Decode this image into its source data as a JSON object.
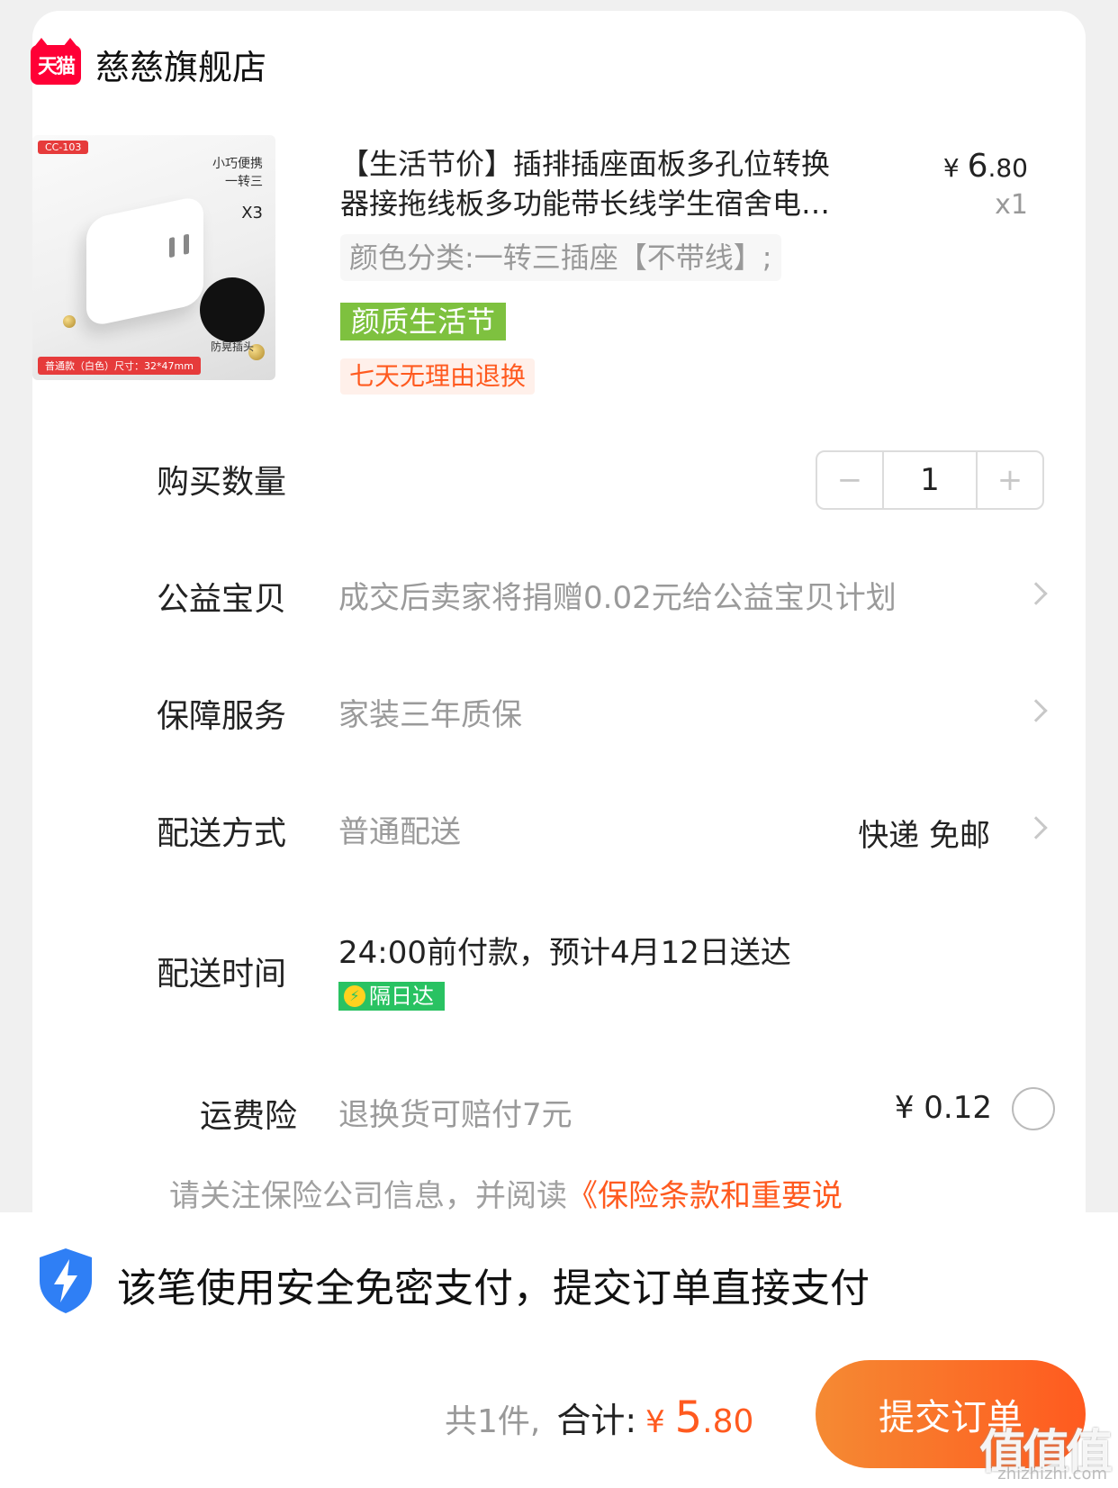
{
  "shop": {
    "logo_text": "天猫",
    "name": "慈慈旗舰店"
  },
  "product": {
    "title_line1": "【生活节价】插排插座面板多孔位转换",
    "title_line2": "器接拖线板多功能带长线学生宿舍电…",
    "price_yen": "¥ ",
    "price_int": "6",
    "price_cents": ".80",
    "quantity_text": "x1",
    "sku": "颜色分类:一转三插座【不带线】;",
    "promo_badge": "颜质生活节",
    "return_badge": "七天无理由退换",
    "image": {
      "tag_top": "CC-103",
      "text1": "小巧便携\n一转三",
      "x3": "X3",
      "anti_text": "防晃插头",
      "tag_bottom": "普通款（白色）尺寸：32*47mm"
    }
  },
  "quantity": {
    "label": "购买数量",
    "minus": "−",
    "value": "1",
    "plus": "+"
  },
  "charity": {
    "label": "公益宝贝",
    "value": "成交后卖家将捐赠0.02元给公益宝贝计划"
  },
  "service": {
    "label": "保障服务",
    "value": "家装三年质保"
  },
  "shipping": {
    "label": "配送方式",
    "value": "普通配送",
    "right": "快递 免邮"
  },
  "delivery_time": {
    "label": "配送时间",
    "value": "24:00前付款，预计4月12日送达",
    "badge": "隔日达",
    "badge_icon": "⚡"
  },
  "insurance": {
    "label": "运费险",
    "value": "退换货可赔付7元",
    "price": "¥ 0.12"
  },
  "notice": {
    "text": "请关注保险公司信息，并阅读",
    "link": "《保险条款和重要说"
  },
  "secure_pay": {
    "text": "该笔使用安全免密支付，提交订单直接支付"
  },
  "footer": {
    "count": "共1件,",
    "total_label": "合计:",
    "total_yen": "¥ ",
    "total_int": "5",
    "total_cents": ".80",
    "submit": "提交订单"
  },
  "watermark": {
    "main": "值值值",
    "sub": "zhizhizhi.com"
  },
  "colors": {
    "accent": "#ff5a1f",
    "promo_green": "#7ec13f",
    "tmall_red": "#ff0036",
    "nextday_green": "#29c262"
  }
}
